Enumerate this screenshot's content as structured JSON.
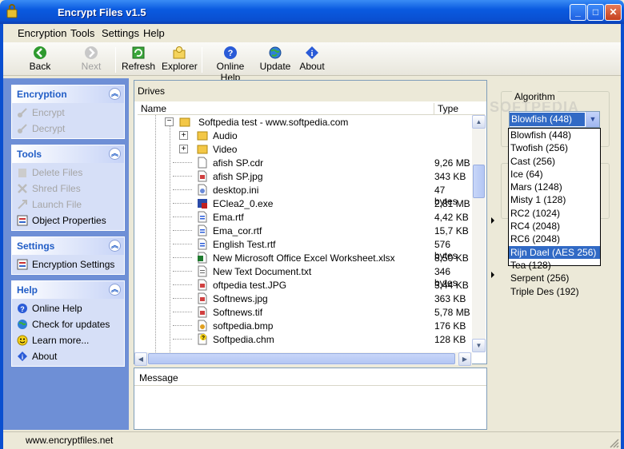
{
  "window": {
    "title": "Encrypt Files v1.5"
  },
  "menu": [
    "Encryption",
    "Tools",
    "Settings",
    "Help"
  ],
  "toolbar": {
    "back": "Back",
    "next": "Next",
    "refresh": "Refresh",
    "explorer": "Explorer",
    "online_help": "Online Help",
    "update": "Update",
    "about": "About"
  },
  "sidebar": {
    "encryption": {
      "title": "Encryption",
      "items": [
        "Encrypt",
        "Decrypt"
      ]
    },
    "tools": {
      "title": "Tools",
      "items": [
        "Delete Files",
        "Shred Files",
        "Launch File",
        "Object Properties"
      ]
    },
    "settings": {
      "title": "Settings",
      "items": [
        "Encryption Settings"
      ]
    },
    "help": {
      "title": "Help",
      "items": [
        "Online Help",
        "Check for updates",
        "Learn more...",
        "About"
      ]
    }
  },
  "tree": {
    "header": "Drives",
    "columns": {
      "name": "Name",
      "type": "Type"
    },
    "root": "Softpedia test - www.softpedia.com",
    "rows": [
      {
        "name": "Audio",
        "size": "",
        "icon": "folder-icon"
      },
      {
        "name": "Video",
        "size": "",
        "icon": "folder-icon"
      },
      {
        "name": "afish SP.cdr",
        "size": "9,26 MB",
        "icon": "file-icon"
      },
      {
        "name": "afish SP.jpg",
        "size": "343 KB",
        "icon": "image-icon"
      },
      {
        "name": "desktop.ini",
        "size": "47 bytes",
        "icon": "settings-file-icon"
      },
      {
        "name": "EClea2_0.exe",
        "size": "2,81 MB",
        "icon": "exe-icon"
      },
      {
        "name": "Ema.rtf",
        "size": "4,42 KB",
        "icon": "rtf-icon"
      },
      {
        "name": "Ema_cor.rtf",
        "size": "15,7 KB",
        "icon": "rtf-icon"
      },
      {
        "name": "English Test.rtf",
        "size": "576 bytes",
        "icon": "rtf-icon"
      },
      {
        "name": "New Microsoft Office Excel Worksheet.xlsx",
        "size": "8,50 KB",
        "icon": "excel-icon"
      },
      {
        "name": "New Text Document.txt",
        "size": "346 bytes",
        "icon": "text-file-icon"
      },
      {
        "name": "oftpedia test.JPG",
        "size": "3,44 KB",
        "icon": "image-icon"
      },
      {
        "name": "Softnews.jpg",
        "size": "363 KB",
        "icon": "image-icon"
      },
      {
        "name": "Softnews.tif",
        "size": "5,78 MB",
        "icon": "image-icon"
      },
      {
        "name": "softpedia.bmp",
        "size": "176 KB",
        "icon": "paint-icon"
      },
      {
        "name": "Softpedia.chm",
        "size": "128 KB",
        "icon": "help-file-icon"
      }
    ]
  },
  "message": {
    "header": "Message"
  },
  "algorithm": {
    "label": "Algorithm",
    "selected": "Blowfish (448)",
    "options": [
      "Blowfish (448)",
      "Twofish (256)",
      "Cast (256)",
      "Ice (64)",
      "Mars (1248)",
      "Misty 1 (128)",
      "RC2 (1024)",
      "RC4 (2048)",
      "RC6 (2048)",
      "Rijn Dael (AES 256)",
      "Tea (128)",
      "Serpent (256)",
      "Triple Des (192)"
    ],
    "highlighted_index": 9
  },
  "watermark": "SOFTPEDIA",
  "status": {
    "text": "www.encryptfiles.net"
  }
}
